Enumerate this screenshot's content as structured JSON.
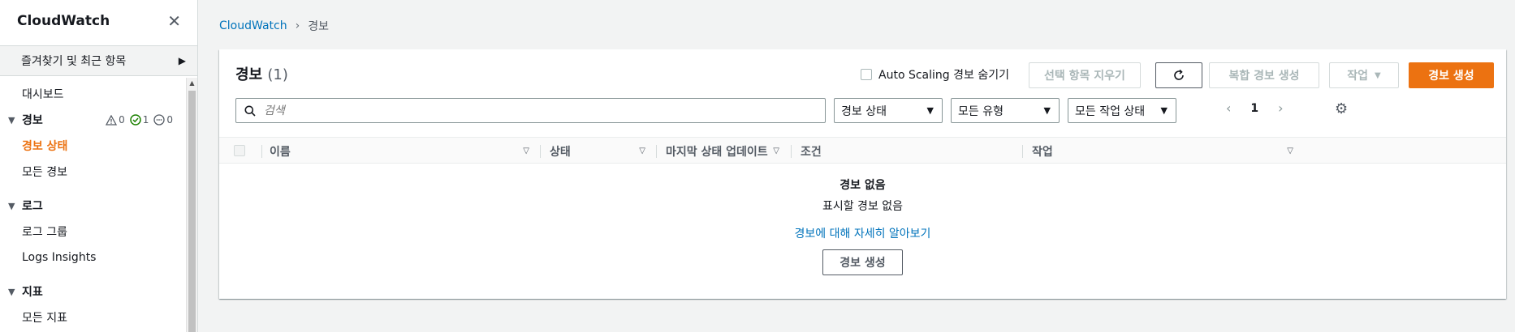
{
  "sidebar": {
    "title": "CloudWatch",
    "favorites": "즐겨찾기 및 최근 항목",
    "dashboard": "대시보드",
    "alarms_section": "경보",
    "alarm_counts": {
      "alarm": "0",
      "ok": "1",
      "insufficient": "0"
    },
    "alarm_items": [
      "경보 상태",
      "모든 경보"
    ],
    "logs_section": "로그",
    "log_items": [
      "로그 그룹",
      "Logs Insights"
    ],
    "metrics_section": "지표",
    "metric_items": [
      "모든 지표"
    ]
  },
  "breadcrumb": {
    "root": "CloudWatch",
    "current": "경보"
  },
  "panel": {
    "title": "경보",
    "count": "(1)",
    "hide_autoscaling": "Auto Scaling 경보 숨기기",
    "clear_selection": "선택 항목 지우기",
    "composite": "복합 경보 생성",
    "actions": "작업",
    "create": "경보 생성",
    "search_placeholder": "검색",
    "filter_state": "경보 상태",
    "filter_type": "모든 유형",
    "filter_action": "모든 작업 상태",
    "page": "1"
  },
  "table": {
    "columns": [
      "이름",
      "상태",
      "마지막 상태 업데이트",
      "조건",
      "작업"
    ],
    "empty_title": "경보 없음",
    "empty_desc": "표시할 경보 없음",
    "learn_more": "경보에 대해 자세히 알아보기",
    "create_button": "경보 생성"
  },
  "colors": {
    "accent": "#ec7211",
    "link": "#0073bb",
    "ok": "#1d8102"
  }
}
